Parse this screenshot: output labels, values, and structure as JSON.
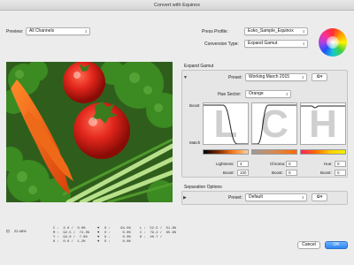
{
  "window": {
    "title": "Convert with Equinox"
  },
  "preview": {
    "label": "Preview:",
    "value": "All Channels"
  },
  "press_profile": {
    "label": "Press Profile:",
    "value": "Esko_Sample_Equinox"
  },
  "conversion_type": {
    "label": "Conversion Type:",
    "value": "Expand Gamut"
  },
  "expand_gamut": {
    "section_title": "Expand Gamut",
    "preset_label": "Preset:",
    "preset_value": "Working March 2015",
    "gear_label": "✿▾",
    "hue_sector_label": "Hue Sector:",
    "hue_sector_value": "Orange",
    "boost_label": "Boost",
    "match_label": "Match",
    "curve_letters": [
      "L",
      "C",
      "H"
    ],
    "lightness_label": "Lightness:",
    "lightness_value": "4",
    "lightness_boost_label": "Boost:",
    "lightness_boost_value": "100",
    "chroma_label": "Chroma:",
    "chroma_value": "0",
    "chroma_boost_label": "Boost:",
    "chroma_boost_value": "0",
    "hue_label": "Hue:",
    "hue_value": "0",
    "hue_boost_label": "Boost:",
    "hue_boost_value": "0"
  },
  "separation_options": {
    "section_title": "Separation Options",
    "preset_label": "Preset:",
    "preset_value": "Default",
    "gear_label": "✿▾"
  },
  "status": {
    "zoom": "22.48%",
    "col1": "C :  2.0 /  0.0%\nM :  92.5 /  74.3%\nY :  94.0 /  7.8%\nK :  0.0 /  1.2%",
    "col2": "O :     94.5%\nO :      0.0%\nG :      0.0%\nS :      0.0%",
    "col3": "L :  52.5 /  51.8%\nC :  79.2 /  85.9%\nH :  40.7 /",
    "col2_marks": "▼\n▼\n▼\n▼"
  },
  "buttons": {
    "cancel": "Cancel",
    "ok": "OK"
  },
  "colors": {
    "accent": "#2d84f0",
    "tomato": "#e2261c",
    "leaf": "#3c8a22"
  }
}
